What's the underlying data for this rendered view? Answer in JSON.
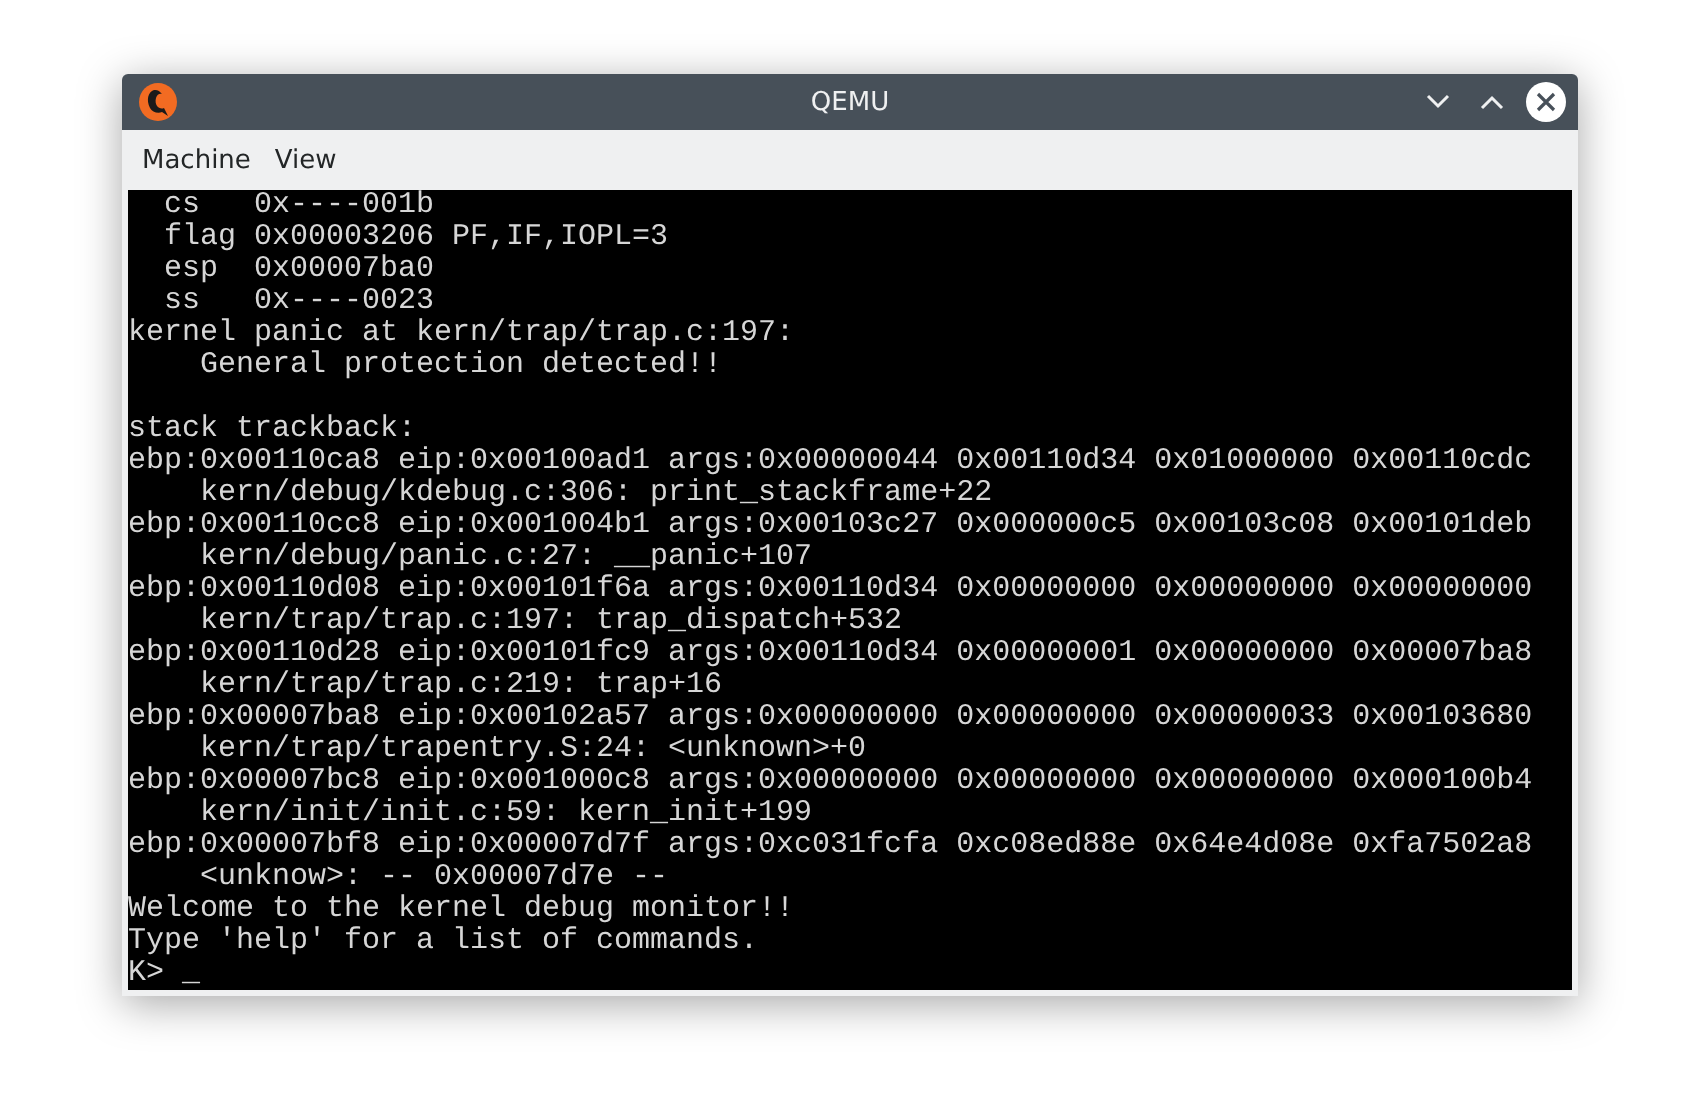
{
  "window": {
    "title": "QEMU"
  },
  "menu": [
    {
      "label": "Machine"
    },
    {
      "label": "View"
    }
  ],
  "terminal": {
    "lines": [
      {
        "kind": "text",
        "text": "  cs   0x----001b"
      },
      {
        "kind": "text",
        "text": "  flag 0x00003206 PF,IF,IOPL=3"
      },
      {
        "kind": "text",
        "text": "  esp  0x00007ba0"
      },
      {
        "kind": "text",
        "text": "  ss   0x----0023"
      },
      {
        "kind": "text",
        "text": "kernel panic at kern/trap/trap.c:197:"
      },
      {
        "kind": "text",
        "text": "    General protection detected!!"
      },
      {
        "kind": "blank"
      },
      {
        "kind": "text",
        "text": "stack trackback:"
      },
      {
        "kind": "text",
        "text": "ebp:0x00110ca8 eip:0x00100ad1 args:0x00000044 0x00110d34 0x01000000 0x00110cdc"
      },
      {
        "kind": "text",
        "text": "    kern/debug/kdebug.c:306: print_stackframe+22"
      },
      {
        "kind": "text",
        "text": "ebp:0x00110cc8 eip:0x001004b1 args:0x00103c27 0x000000c5 0x00103c08 0x00101deb"
      },
      {
        "kind": "text",
        "text": "    kern/debug/panic.c:27: __panic+107"
      },
      {
        "kind": "text",
        "text": "ebp:0x00110d08 eip:0x00101f6a args:0x00110d34 0x00000000 0x00000000 0x00000000"
      },
      {
        "kind": "text",
        "text": "    kern/trap/trap.c:197: trap_dispatch+532"
      },
      {
        "kind": "text",
        "text": "ebp:0x00110d28 eip:0x00101fc9 args:0x00110d34 0x00000001 0x00000000 0x00007ba8"
      },
      {
        "kind": "text",
        "text": "    kern/trap/trap.c:219: trap+16"
      },
      {
        "kind": "text",
        "text": "ebp:0x00007ba8 eip:0x00102a57 args:0x00000000 0x00000000 0x00000033 0x00103680"
      },
      {
        "kind": "text",
        "text": "    kern/trap/trapentry.S:24: <unknown>+0"
      },
      {
        "kind": "text",
        "text": "ebp:0x00007bc8 eip:0x001000c8 args:0x00000000 0x00000000 0x00000000 0x000100b4"
      },
      {
        "kind": "text",
        "text": "    kern/init/init.c:59: kern_init+199"
      },
      {
        "kind": "text",
        "text": "ebp:0x00007bf8 eip:0x00007d7f args:0xc031fcfa 0xc08ed88e 0x64e4d08e 0xfa7502a8"
      },
      {
        "kind": "text",
        "text": "    <unknow>: -- 0x00007d7e --"
      },
      {
        "kind": "text",
        "text": "Welcome to the kernel debug monitor!!"
      },
      {
        "kind": "text",
        "text": "Type 'help' for a list of commands."
      },
      {
        "kind": "text",
        "text": "K> _"
      }
    ]
  }
}
